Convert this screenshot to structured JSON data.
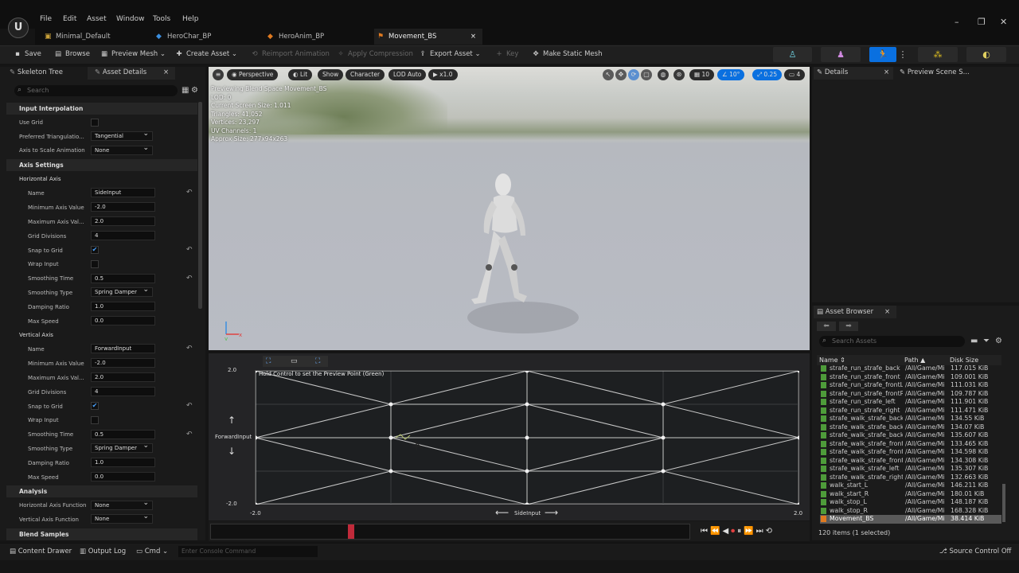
{
  "menu": [
    "File",
    "Edit",
    "Asset",
    "Window",
    "Tools",
    "Help"
  ],
  "tabs": [
    {
      "label": "Minimal_Default",
      "icon": "level-icon"
    },
    {
      "label": "HeroChar_BP",
      "icon": "blueprint-icon"
    },
    {
      "label": "HeroAnim_BP",
      "icon": "anim-blueprint-icon"
    },
    {
      "label": "Movement_BS",
      "icon": "blendspace-icon"
    }
  ],
  "toolbar": {
    "save": "Save",
    "browse": "Browse",
    "preview_mesh": "Preview Mesh",
    "create_asset": "Create Asset",
    "reimport": "Reimport Animation",
    "apply_compression": "Apply Compression",
    "export_asset": "Export Asset",
    "key": "Key",
    "make_static_mesh": "Make Static Mesh"
  },
  "left_panel": {
    "tab1": "Skeleton Tree",
    "tab2": "Asset Details",
    "search_placeholder": "Search",
    "input_interpolation": "Input Interpolation",
    "use_grid": "Use Grid",
    "preferred_triangulation": "Preferred Triangulatio...",
    "preferred_triangulation_value": "Tangential",
    "axis_to_scale": "Axis to Scale Animation",
    "axis_to_scale_value": "None",
    "axis_settings": "Axis Settings",
    "horizontal_axis": "Horizontal Axis",
    "vertical_axis": "Vertical Axis",
    "name": "Name",
    "min_axis": "Minimum Axis Value",
    "max_axis": "Maximum Axis Val...",
    "grid_divisions": "Grid Divisions",
    "snap_to_grid": "Snap to Grid",
    "wrap_input": "Wrap Input",
    "smoothing_time": "Smoothing Time",
    "smoothing_type": "Smoothing Type",
    "damping_ratio": "Damping Ratio",
    "max_speed": "Max Speed",
    "h": {
      "name": "SideInput",
      "min": "-2.0",
      "max": "2.0",
      "div": "4",
      "smooth_time": "0.5",
      "smooth_type": "Spring Damper",
      "damping": "1.0",
      "max_speed": "0.0"
    },
    "v": {
      "name": "ForwardInput",
      "min": "-2.0",
      "max": "2.0",
      "div": "4",
      "smooth_time": "0.5",
      "smooth_type": "Spring Damper",
      "damping": "1.0",
      "max_speed": "0.0"
    },
    "analysis": "Analysis",
    "h_axis_func": "Horizontal Axis Function",
    "h_axis_func_value": "None",
    "v_axis_func": "Vertical Axis Function",
    "v_axis_func_value": "None",
    "blend_samples": "Blend Samples"
  },
  "viewport": {
    "perspective": "Perspective",
    "lit": "Lit",
    "show": "Show",
    "character": "Character",
    "lod": "LOD Auto",
    "speed": "x1.0",
    "grid_size": "10",
    "angle": "10°",
    "scale": "0.25",
    "cams": "4",
    "stats": [
      "Previewing Blend Space Movement_BS",
      "LOD: 0",
      "Current Screen Size: 1.011",
      "Triangles: 41,052",
      "Vertices: 23,297",
      "UV Channels: 1",
      "Approx Size: 277x94x263"
    ]
  },
  "blend": {
    "hint": "Hold Control to set the Preview Point (Green)",
    "y_label": "ForwardInput",
    "x_label": "SideInput",
    "y_max": "2.0",
    "y_min": "-2.0",
    "x_min": "-2.0",
    "x_max": "2.0"
  },
  "right": {
    "details": "Details",
    "preview_scene": "Preview Scene S..."
  },
  "asset_browser": {
    "title": "Asset Browser",
    "search_placeholder": "Search Assets",
    "col_name": "Name",
    "col_path": "Path",
    "col_size": "Disk Size",
    "rows": [
      {
        "name": "strafe_run_strafe_back",
        "path": "/All/Game/Mi",
        "size": "117.015 KiB"
      },
      {
        "name": "strafe_run_strafe_front",
        "path": "/All/Game/Mi",
        "size": "109.001 KiB"
      },
      {
        "name": "strafe_run_strafe_frontL",
        "path": "/All/Game/Mi",
        "size": "111.031 KiB"
      },
      {
        "name": "strafe_run_strafe_frontR",
        "path": "/All/Game/Mi",
        "size": "109.787 KiB"
      },
      {
        "name": "strafe_run_strafe_left",
        "path": "/All/Game/Mi",
        "size": "111.901 KiB"
      },
      {
        "name": "strafe_run_strafe_right",
        "path": "/All/Game/Mi",
        "size": "111.471 KiB"
      },
      {
        "name": "strafe_walk_strafe_back",
        "path": "/All/Game/Mi",
        "size": "134.55 KiB"
      },
      {
        "name": "strafe_walk_strafe_back",
        "path": "/All/Game/Mi",
        "size": "134.07 KiB"
      },
      {
        "name": "strafe_walk_strafe_back",
        "path": "/All/Game/Mi",
        "size": "135.607 KiB"
      },
      {
        "name": "strafe_walk_strafe_front",
        "path": "/All/Game/Mi",
        "size": "133.465 KiB"
      },
      {
        "name": "strafe_walk_strafe_front",
        "path": "/All/Game/Mi",
        "size": "134.598 KiB"
      },
      {
        "name": "strafe_walk_strafe_front",
        "path": "/All/Game/Mi",
        "size": "134.308 KiB"
      },
      {
        "name": "strafe_walk_strafe_left",
        "path": "/All/Game/Mi",
        "size": "135.307 KiB"
      },
      {
        "name": "strafe_walk_strafe_right",
        "path": "/All/Game/Mi",
        "size": "132.663 KiB"
      },
      {
        "name": "walk_start_L",
        "path": "/All/Game/Mi",
        "size": "146.211 KiB"
      },
      {
        "name": "walk_start_R",
        "path": "/All/Game/Mi",
        "size": "180.01 KiB"
      },
      {
        "name": "walk_stop_L",
        "path": "/All/Game/Mi",
        "size": "148.187 KiB"
      },
      {
        "name": "walk_stop_R",
        "path": "/All/Game/Mi",
        "size": "168.328 KiB"
      },
      {
        "name": "Movement_BS",
        "path": "/All/Game/Mi",
        "size": "38.414 KiB",
        "selected": true
      }
    ],
    "count": "120 items (1 selected)"
  },
  "status": {
    "content_drawer": "Content Drawer",
    "output_log": "Output Log",
    "cmd": "Cmd",
    "console_placeholder": "Enter Console Command",
    "source_control": "Source Control Off"
  }
}
